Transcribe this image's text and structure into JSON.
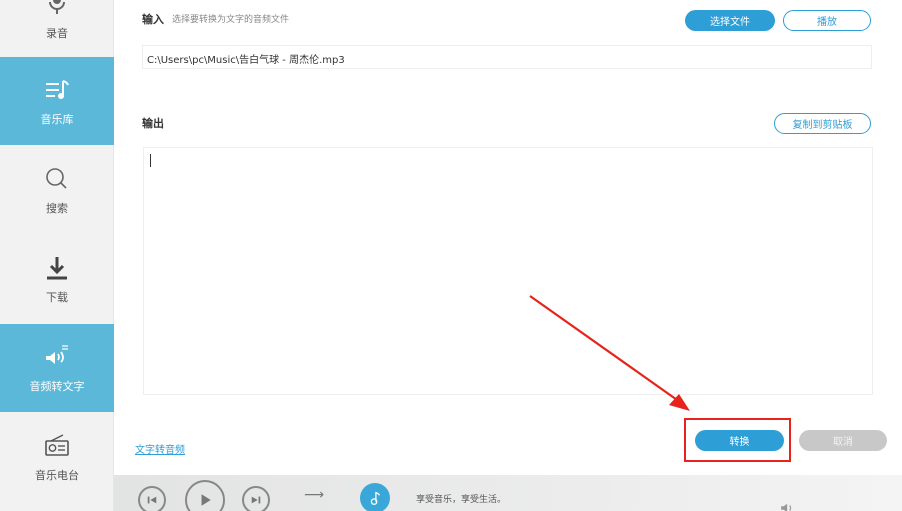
{
  "sidebar": {
    "items": [
      {
        "label": "录音",
        "icon": "microphone-icon",
        "active": false
      },
      {
        "label": "音乐库",
        "icon": "music-library-icon",
        "active": true
      },
      {
        "label": "搜索",
        "icon": "search-icon",
        "active": false
      },
      {
        "label": "下载",
        "icon": "download-icon",
        "active": false
      },
      {
        "label": "音频转文字",
        "icon": "speaker-convert-icon",
        "active": true
      },
      {
        "label": "音乐电台",
        "icon": "radio-icon",
        "active": false
      }
    ]
  },
  "input_section": {
    "label": "输入",
    "hint": "选择要转换为文字的音频文件",
    "choose_file_label": "选择文件",
    "play_label": "播放",
    "file_path": "C:\\Users\\pc\\Music\\告白气球 - 周杰伦.mp3"
  },
  "output_section": {
    "label": "输出",
    "copy_label": "复制到剪贴板",
    "text": ""
  },
  "footer": {
    "text_to_audio_link": "文字转音频",
    "convert_label": "转换",
    "cancel_label": "取消"
  },
  "player": {
    "tagline": "享受音乐，享受生活。"
  },
  "colors": {
    "accent": "#2e9ed6",
    "sidebar_active": "#5bb8d9",
    "annotation_red": "#e8231b"
  }
}
